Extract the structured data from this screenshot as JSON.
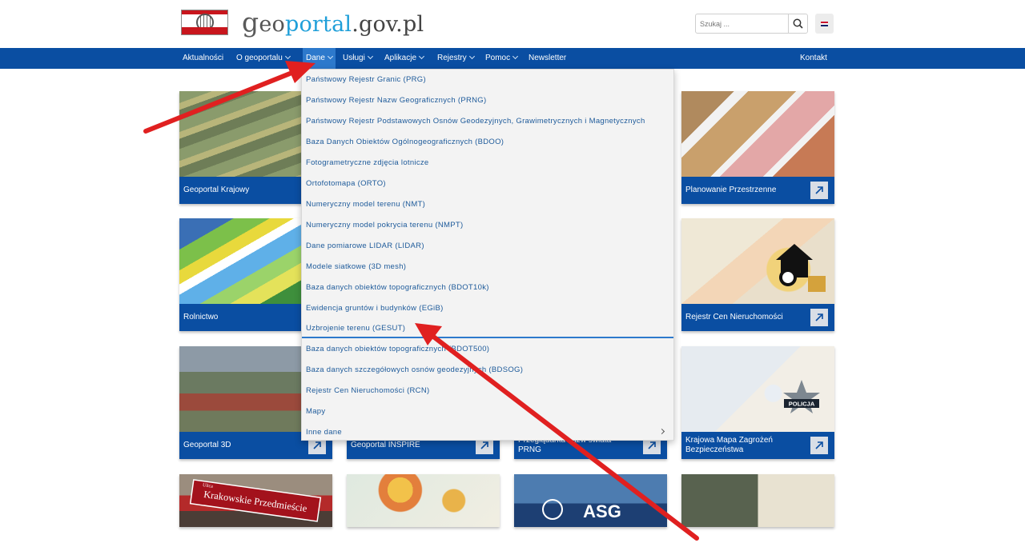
{
  "header": {
    "logo_text_g": "g",
    "logo_text_eo": "eo",
    "logo_text_portal": "portal",
    "logo_text_rest": ".gov.pl",
    "search_placeholder": "Szukaj ...",
    "lang_flag": "flag-gb-icon"
  },
  "nav": {
    "items": [
      {
        "label": "Aktualności"
      },
      {
        "label": "O geoportalu"
      },
      {
        "label": "Dane"
      },
      {
        "label": "Usługi"
      },
      {
        "label": "Aplikacje"
      },
      {
        "label": "Rejestry"
      },
      {
        "label": "Pomoc"
      },
      {
        "label": "Newsletter"
      },
      {
        "label": "Kontakt"
      }
    ]
  },
  "dropdown": {
    "items": [
      "Państwowy Rejestr Granic (PRG)",
      "Państwowy Rejestr Nazw Geograficznych (PRNG)",
      "Państwowy Rejestr Podstawowych Osnów Geodezyjnych, Grawimetrycznych i Magnetycznych",
      "Baza Danych Obiektów Ogólnogeograficznych (BDOO)",
      "Fotogrametryczne zdjęcia lotnicze",
      "Ortofotomapa (ORTO)",
      "Numeryczny model terenu (NMT)",
      "Numeryczny model pokrycia terenu (NMPT)",
      "Dane pomiarowe LIDAR (LIDAR)",
      "Modele siatkowe (3D mesh)",
      "Baza danych obiektów topograficznych (BDOT10k)",
      "Ewidencja gruntów i budynków (EGiB)",
      "Uzbrojenie terenu (GESUT)",
      "Baza danych obiektów topograficznych (BDOT500)",
      "Baza danych szczegółowych osnów geodezyjnych (BDSOG)",
      "Rejestr Cen Nieruchomości (RCN)",
      "Mapy",
      "Inne dane"
    ]
  },
  "tiles": {
    "krajowy": "Geoportal Krajowy",
    "planowanie": "Planowanie Przestrzenne",
    "rolnictwo": "Rolnictwo",
    "rcn": "Rejestr Cen Nieruchomości",
    "g3d": "Geoportal 3D",
    "inspire": "Geoportal INSPIRE",
    "prng_line1": "Przeglądarka nazw świata",
    "prng_line2": "PRNG",
    "police_line1": "Krajowa Mapa Zagrożeń",
    "police_line2": "Bezpieczeństwa",
    "police_badge": "POLICJA",
    "krak_sign": "Krakowskie Przedmieście",
    "krak_sign_small": "Ulica",
    "asg": "ASG"
  },
  "colors": {
    "nav_bg": "#0a4ea2",
    "nav_active": "#2d79cc",
    "dropdown_bg": "#f3f3f3",
    "dropdown_text": "#1d5a9a",
    "annotation_red": "#e02020"
  }
}
